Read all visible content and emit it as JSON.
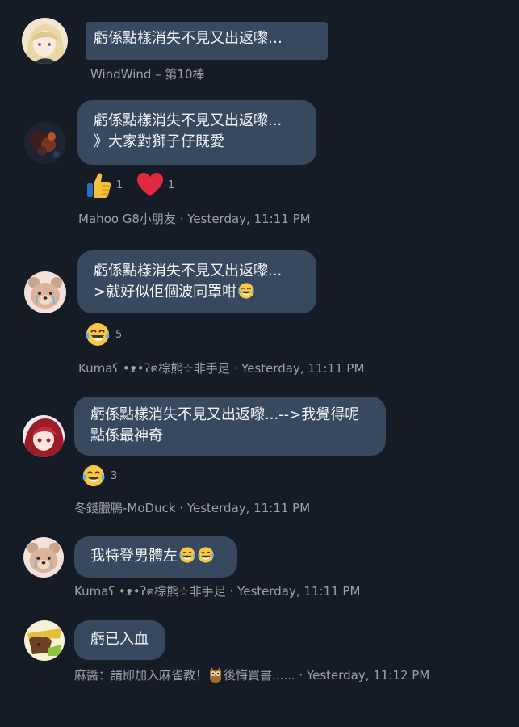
{
  "colors": {
    "background": "#161c26",
    "bubble": "#37495e",
    "bubble_text": "#f2f4f7",
    "meta_text": "#98a2ae",
    "heart": "#e0283e",
    "thumb": "#f5c03c"
  },
  "messages": [
    {
      "avatar": "anime-girl-avatar",
      "text_lines": [
        "虧係點樣消失不見又出返嚟…"
      ],
      "meta": "WindWind – 第10棒"
    },
    {
      "avatar": "dark-photo-avatar",
      "text_lines": [
        "虧係點樣消失不見又出返嚟...",
        "》大家對獅子仔既愛"
      ],
      "reactions": [
        {
          "icon": "thumbs-up-icon",
          "count": "1"
        },
        {
          "icon": "heart-icon",
          "count": "1"
        }
      ],
      "meta": "Mahoo G8小朋友 · Yesterday, 11:11 PM"
    },
    {
      "avatar": "bear-avatar",
      "text_lines": [
        "虧係點樣消失不見又出返嚟...",
        ">就好似佢個波同罩咁"
      ],
      "text_emoji": [
        "laughing-tears-emoji"
      ],
      "reactions": [
        {
          "icon": "laughing-tears-icon",
          "count": "5"
        }
      ],
      "meta": "Kumaʕ •ᴥ•ʔฅ棕熊☆非手足 · Yesterday, 11:11 PM"
    },
    {
      "avatar": "red-hair-anime-avatar",
      "text_lines": [
        "虧係點樣消失不見又出返嚟...-->我覺得呢",
        "點係最神奇"
      ],
      "reactions": [
        {
          "icon": "laughing-tears-icon",
          "count": "3"
        }
      ],
      "meta": "冬錢臘鴨-MoDuck · Yesterday, 11:11 PM"
    },
    {
      "avatar": "bear-avatar",
      "text_lines": [
        "我特登男體左"
      ],
      "text_emoji": [
        "laughing-tears-emoji",
        "laughing-tears-emoji"
      ],
      "meta": "Kumaʕ •ᴥ•ʔฅ棕熊☆非手足 · Yesterday, 11:11 PM"
    },
    {
      "avatar": "cartoon-avatar",
      "text_lines": [
        "虧已入血"
      ],
      "meta_before": "麻醬：請即加入麻雀教！",
      "meta_emoji": "owl-emoji",
      "meta": "後悔買書...... · Yesterday, 11:12 PM"
    }
  ]
}
